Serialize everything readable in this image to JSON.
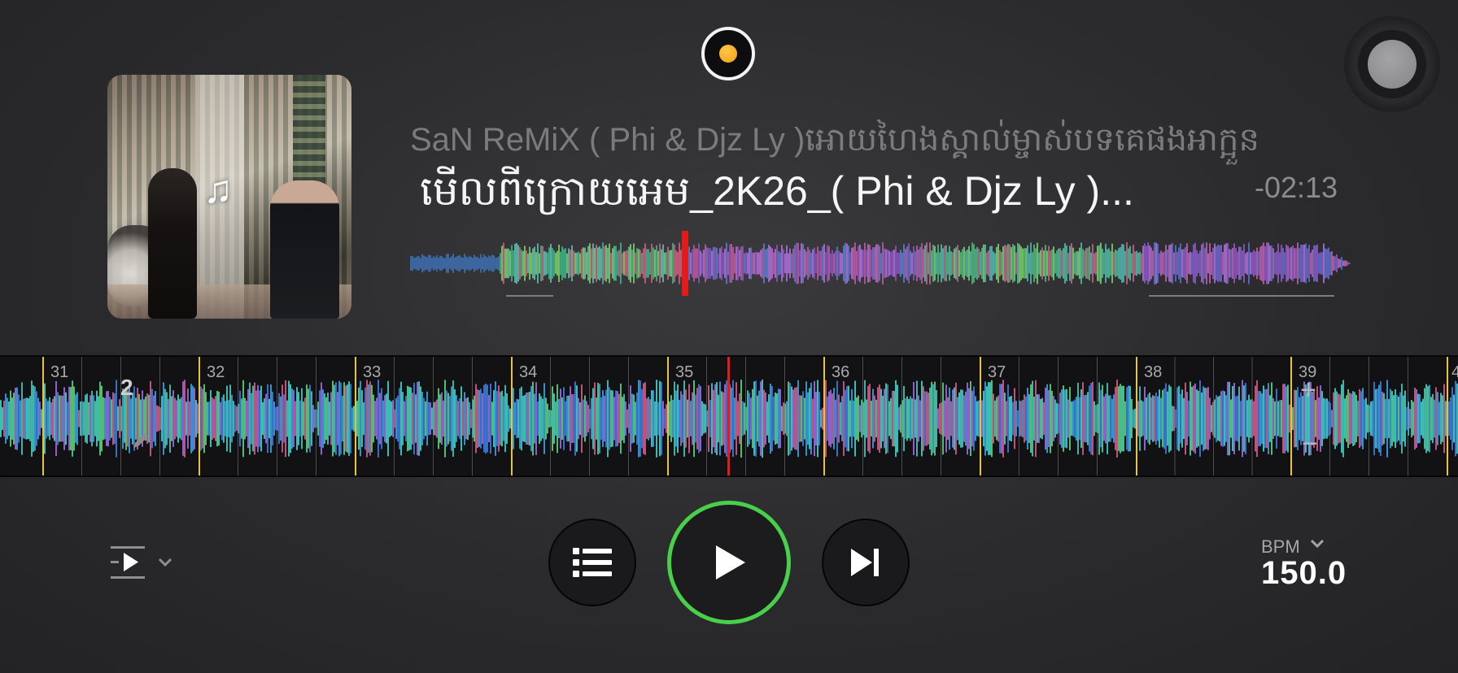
{
  "header": {
    "record_button": "record-button",
    "settings_knob": "knob"
  },
  "track": {
    "artist_line": "SaN ReMiX ( Phi & Djz Ly )អោយហៃងស្គាល់ម្ចាស់បទគេផងអាក្អួន",
    "title": "មើលពីក្រោយអេម_2K26_( Phi & Djz Ly )...",
    "time_remaining": "-02:13",
    "album_art_icon": "music-note-icon"
  },
  "waveform": {
    "beat_numbers": [
      "31",
      "32",
      "33",
      "34",
      "35",
      "36",
      "37",
      "38",
      "39",
      "4"
    ],
    "cue_number": "2",
    "zoom_in": "+",
    "zoom_out": "−"
  },
  "controls": {
    "queue_mode_icon": "play-queue-icon",
    "playlist_icon": "list-icon",
    "play_icon": "play-icon",
    "next_icon": "skip-next-icon",
    "play_ring_color": "#48d04a"
  },
  "bpm": {
    "label": "BPM",
    "value": "150.0"
  },
  "colors": {
    "accent_green": "#48d04a",
    "marker_red": "#e31b1b",
    "record_yellow": "#f5a00f",
    "beat_yellow": "#e8c43a"
  }
}
